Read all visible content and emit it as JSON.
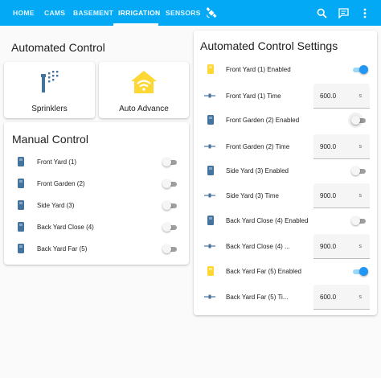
{
  "nav": {
    "tabs": [
      {
        "label": "HOME"
      },
      {
        "label": "CAMS"
      },
      {
        "label": "BASEMENT"
      },
      {
        "label": "IRRIGATION"
      },
      {
        "label": "SENSORS"
      }
    ],
    "active_tab": "IRRIGATION",
    "icons": [
      "satellite-icon",
      "search-icon",
      "chat-icon",
      "more-vert-icon"
    ]
  },
  "automated_control": {
    "title": "Automated Control",
    "tiles": [
      {
        "label": "Sprinklers",
        "icon": "sprinkler-icon"
      },
      {
        "label": "Auto Advance",
        "icon": "wifi-house-icon",
        "icon_color": "#fdd835"
      }
    ]
  },
  "manual_control": {
    "title": "Manual Control",
    "rows": [
      {
        "label": "Front Yard (1)",
        "on": false
      },
      {
        "label": "Front Garden (2)",
        "on": false
      },
      {
        "label": "Side Yard (3)",
        "on": false
      },
      {
        "label": "Back Yard Close (4)",
        "on": false
      },
      {
        "label": "Back Yard Far (5)",
        "on": false
      }
    ]
  },
  "settings": {
    "title": "Automated Control Settings",
    "rows": [
      {
        "label": "Front Yard (1) Enabled",
        "type": "toggle",
        "on": true
      },
      {
        "label": "Front Yard (1) Time",
        "type": "number",
        "value": "600.0",
        "unit": "s"
      },
      {
        "label": "Front Garden (2) Enabled",
        "type": "toggle",
        "on": false
      },
      {
        "label": "Front Garden (2) Time",
        "type": "number",
        "value": "900.0",
        "unit": "s"
      },
      {
        "label": "Side Yard (3) Enabled",
        "type": "toggle",
        "on": false
      },
      {
        "label": "Side Yard (3) Time",
        "type": "number",
        "value": "900.0",
        "unit": "s"
      },
      {
        "label": "Back Yard Close (4) Enabled",
        "type": "toggle",
        "on": false
      },
      {
        "label": "Back Yard Close (4) ...",
        "type": "number",
        "value": "900.0",
        "unit": "s"
      },
      {
        "label": "Back Yard Far (5) Enabled",
        "type": "toggle",
        "on": true
      },
      {
        "label": "Back Yard Far (5) Ti...",
        "type": "number",
        "value": "600.0",
        "unit": "s"
      }
    ]
  },
  "colors": {
    "accent": "#03a9f4",
    "toggle_on": "#2196f3",
    "icon_on": "#fdd835",
    "icon_off": "#44739e"
  }
}
